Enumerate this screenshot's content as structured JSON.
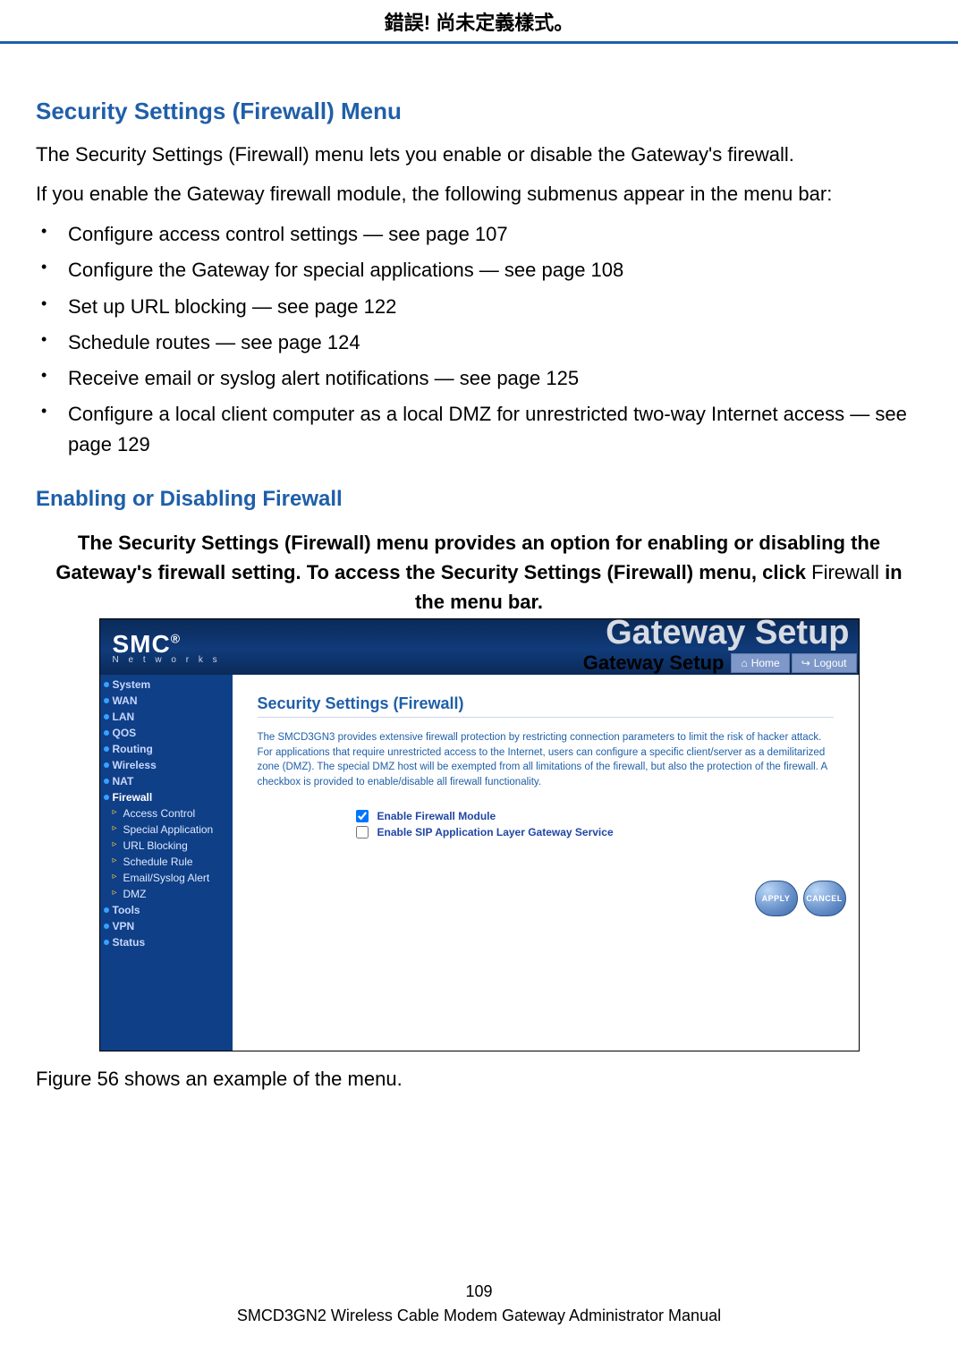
{
  "header": {
    "error": "錯誤! 尚未定義樣式。"
  },
  "doc": {
    "h1": "Security Settings (Firewall) Menu",
    "p1": "The Security Settings (Firewall) menu lets you enable or disable the Gateway's firewall.",
    "p2": "If you enable the Gateway firewall module, the following submenus appear in the menu bar:",
    "bullets": [
      "Configure access control settings — see page 107",
      "Configure the Gateway for special applications — see page 108",
      "Set up URL blocking — see page 122",
      "Schedule routes — see page 124",
      "Receive email or syslog alert notifications — see page 125",
      "Configure a local client computer as a local DMZ for unrestricted two-way Internet access — see page 129"
    ],
    "h2": "Enabling or Disabling Firewall",
    "intro_a": "The Security Settings (Firewall) menu provides an option for enabling or disabling the Gateway's firewall setting. To access the Security Settings (Firewall) menu, click ",
    "intro_nonbold": "Firewall",
    "intro_b": " in the menu bar.",
    "caption": "Figure 56 shows an example of the menu."
  },
  "screenshot": {
    "logo": "SMC",
    "logo_sub": "N e t w o r k s",
    "watermark": "Gateway Setup",
    "subbar_label": "Gateway Setup",
    "home": "Home",
    "logout": "Logout",
    "sidebar_top": [
      "System",
      "WAN",
      "LAN",
      "QOS",
      "Routing",
      "Wireless",
      "NAT"
    ],
    "sidebar_active": "Firewall",
    "sidebar_sub": [
      "Access Control",
      "Special Application",
      "URL Blocking",
      "Schedule Rule",
      "Email/Syslog Alert",
      "DMZ"
    ],
    "sidebar_bottom": [
      "Tools",
      "VPN",
      "Status"
    ],
    "panel_title": "Security Settings (Firewall)",
    "panel_desc": "The SMCD3GN3 provides extensive firewall protection by restricting connection parameters to limit the risk of hacker attack. For applications that require unrestricted access to the Internet, users can configure a specific client/server as a demilitarized zone (DMZ). The special DMZ host will be exempted from all limitations of the firewall, but also the protection of the firewall. A checkbox is provided to enable/disable all firewall functionality.",
    "cb1_label": "Enable Firewall Module",
    "cb1_checked": true,
    "cb2_label": "Enable SIP Application Layer Gateway Service",
    "cb2_checked": false,
    "apply": "APPLY",
    "cancel": "CANCEL"
  },
  "footer": {
    "page_num": "109",
    "manual": "SMCD3GN2 Wireless Cable Modem Gateway Administrator Manual"
  }
}
